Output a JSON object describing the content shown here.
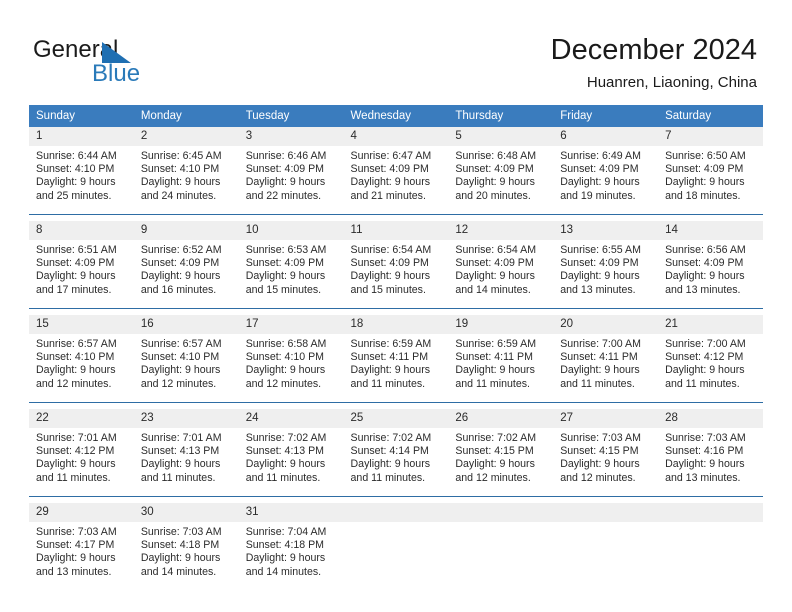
{
  "brand": {
    "name_part1": "General",
    "name_part2": "Blue",
    "accent_color": "#2a7ab9"
  },
  "header": {
    "title": "December 2024",
    "subtitle": "Huanren, Liaoning, China"
  },
  "theme": {
    "header_row_color": "#3a7cbe",
    "daynum_strip_color": "#efefef",
    "row_border_color": "#2e6da4"
  },
  "calendar": {
    "weekday_headers": [
      "Sunday",
      "Monday",
      "Tuesday",
      "Wednesday",
      "Thursday",
      "Friday",
      "Saturday"
    ],
    "weeks": [
      [
        {
          "day": "1",
          "line1": "Sunrise: 6:44 AM",
          "line2": "Sunset: 4:10 PM",
          "line3": "Daylight: 9 hours",
          "line4": "and 25 minutes."
        },
        {
          "day": "2",
          "line1": "Sunrise: 6:45 AM",
          "line2": "Sunset: 4:10 PM",
          "line3": "Daylight: 9 hours",
          "line4": "and 24 minutes."
        },
        {
          "day": "3",
          "line1": "Sunrise: 6:46 AM",
          "line2": "Sunset: 4:09 PM",
          "line3": "Daylight: 9 hours",
          "line4": "and 22 minutes."
        },
        {
          "day": "4",
          "line1": "Sunrise: 6:47 AM",
          "line2": "Sunset: 4:09 PM",
          "line3": "Daylight: 9 hours",
          "line4": "and 21 minutes."
        },
        {
          "day": "5",
          "line1": "Sunrise: 6:48 AM",
          "line2": "Sunset: 4:09 PM",
          "line3": "Daylight: 9 hours",
          "line4": "and 20 minutes."
        },
        {
          "day": "6",
          "line1": "Sunrise: 6:49 AM",
          "line2": "Sunset: 4:09 PM",
          "line3": "Daylight: 9 hours",
          "line4": "and 19 minutes."
        },
        {
          "day": "7",
          "line1": "Sunrise: 6:50 AM",
          "line2": "Sunset: 4:09 PM",
          "line3": "Daylight: 9 hours",
          "line4": "and 18 minutes."
        }
      ],
      [
        {
          "day": "8",
          "line1": "Sunrise: 6:51 AM",
          "line2": "Sunset: 4:09 PM",
          "line3": "Daylight: 9 hours",
          "line4": "and 17 minutes."
        },
        {
          "day": "9",
          "line1": "Sunrise: 6:52 AM",
          "line2": "Sunset: 4:09 PM",
          "line3": "Daylight: 9 hours",
          "line4": "and 16 minutes."
        },
        {
          "day": "10",
          "line1": "Sunrise: 6:53 AM",
          "line2": "Sunset: 4:09 PM",
          "line3": "Daylight: 9 hours",
          "line4": "and 15 minutes."
        },
        {
          "day": "11",
          "line1": "Sunrise: 6:54 AM",
          "line2": "Sunset: 4:09 PM",
          "line3": "Daylight: 9 hours",
          "line4": "and 15 minutes."
        },
        {
          "day": "12",
          "line1": "Sunrise: 6:54 AM",
          "line2": "Sunset: 4:09 PM",
          "line3": "Daylight: 9 hours",
          "line4": "and 14 minutes."
        },
        {
          "day": "13",
          "line1": "Sunrise: 6:55 AM",
          "line2": "Sunset: 4:09 PM",
          "line3": "Daylight: 9 hours",
          "line4": "and 13 minutes."
        },
        {
          "day": "14",
          "line1": "Sunrise: 6:56 AM",
          "line2": "Sunset: 4:09 PM",
          "line3": "Daylight: 9 hours",
          "line4": "and 13 minutes."
        }
      ],
      [
        {
          "day": "15",
          "line1": "Sunrise: 6:57 AM",
          "line2": "Sunset: 4:10 PM",
          "line3": "Daylight: 9 hours",
          "line4": "and 12 minutes."
        },
        {
          "day": "16",
          "line1": "Sunrise: 6:57 AM",
          "line2": "Sunset: 4:10 PM",
          "line3": "Daylight: 9 hours",
          "line4": "and 12 minutes."
        },
        {
          "day": "17",
          "line1": "Sunrise: 6:58 AM",
          "line2": "Sunset: 4:10 PM",
          "line3": "Daylight: 9 hours",
          "line4": "and 12 minutes."
        },
        {
          "day": "18",
          "line1": "Sunrise: 6:59 AM",
          "line2": "Sunset: 4:11 PM",
          "line3": "Daylight: 9 hours",
          "line4": "and 11 minutes."
        },
        {
          "day": "19",
          "line1": "Sunrise: 6:59 AM",
          "line2": "Sunset: 4:11 PM",
          "line3": "Daylight: 9 hours",
          "line4": "and 11 minutes."
        },
        {
          "day": "20",
          "line1": "Sunrise: 7:00 AM",
          "line2": "Sunset: 4:11 PM",
          "line3": "Daylight: 9 hours",
          "line4": "and 11 minutes."
        },
        {
          "day": "21",
          "line1": "Sunrise: 7:00 AM",
          "line2": "Sunset: 4:12 PM",
          "line3": "Daylight: 9 hours",
          "line4": "and 11 minutes."
        }
      ],
      [
        {
          "day": "22",
          "line1": "Sunrise: 7:01 AM",
          "line2": "Sunset: 4:12 PM",
          "line3": "Daylight: 9 hours",
          "line4": "and 11 minutes."
        },
        {
          "day": "23",
          "line1": "Sunrise: 7:01 AM",
          "line2": "Sunset: 4:13 PM",
          "line3": "Daylight: 9 hours",
          "line4": "and 11 minutes."
        },
        {
          "day": "24",
          "line1": "Sunrise: 7:02 AM",
          "line2": "Sunset: 4:13 PM",
          "line3": "Daylight: 9 hours",
          "line4": "and 11 minutes."
        },
        {
          "day": "25",
          "line1": "Sunrise: 7:02 AM",
          "line2": "Sunset: 4:14 PM",
          "line3": "Daylight: 9 hours",
          "line4": "and 11 minutes."
        },
        {
          "day": "26",
          "line1": "Sunrise: 7:02 AM",
          "line2": "Sunset: 4:15 PM",
          "line3": "Daylight: 9 hours",
          "line4": "and 12 minutes."
        },
        {
          "day": "27",
          "line1": "Sunrise: 7:03 AM",
          "line2": "Sunset: 4:15 PM",
          "line3": "Daylight: 9 hours",
          "line4": "and 12 minutes."
        },
        {
          "day": "28",
          "line1": "Sunrise: 7:03 AM",
          "line2": "Sunset: 4:16 PM",
          "line3": "Daylight: 9 hours",
          "line4": "and 13 minutes."
        }
      ],
      [
        {
          "day": "29",
          "line1": "Sunrise: 7:03 AM",
          "line2": "Sunset: 4:17 PM",
          "line3": "Daylight: 9 hours",
          "line4": "and 13 minutes."
        },
        {
          "day": "30",
          "line1": "Sunrise: 7:03 AM",
          "line2": "Sunset: 4:18 PM",
          "line3": "Daylight: 9 hours",
          "line4": "and 14 minutes."
        },
        {
          "day": "31",
          "line1": "Sunrise: 7:04 AM",
          "line2": "Sunset: 4:18 PM",
          "line3": "Daylight: 9 hours",
          "line4": "and 14 minutes."
        },
        {
          "day": "",
          "line1": "",
          "line2": "",
          "line3": "",
          "line4": ""
        },
        {
          "day": "",
          "line1": "",
          "line2": "",
          "line3": "",
          "line4": ""
        },
        {
          "day": "",
          "line1": "",
          "line2": "",
          "line3": "",
          "line4": ""
        },
        {
          "day": "",
          "line1": "",
          "line2": "",
          "line3": "",
          "line4": ""
        }
      ]
    ]
  }
}
